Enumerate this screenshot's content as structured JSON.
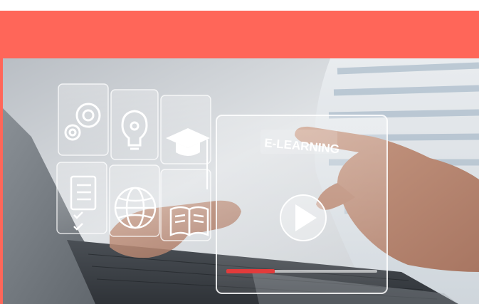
{
  "banner": {
    "color": "#ff6659"
  },
  "hero_image": {
    "screen_text": "E-LEARNING",
    "icons": [
      "gears-icon",
      "lightbulb-icon",
      "graduation-cap-icon",
      "checklist-icon",
      "globe-icon",
      "open-book-icon",
      "play-icon"
    ]
  }
}
